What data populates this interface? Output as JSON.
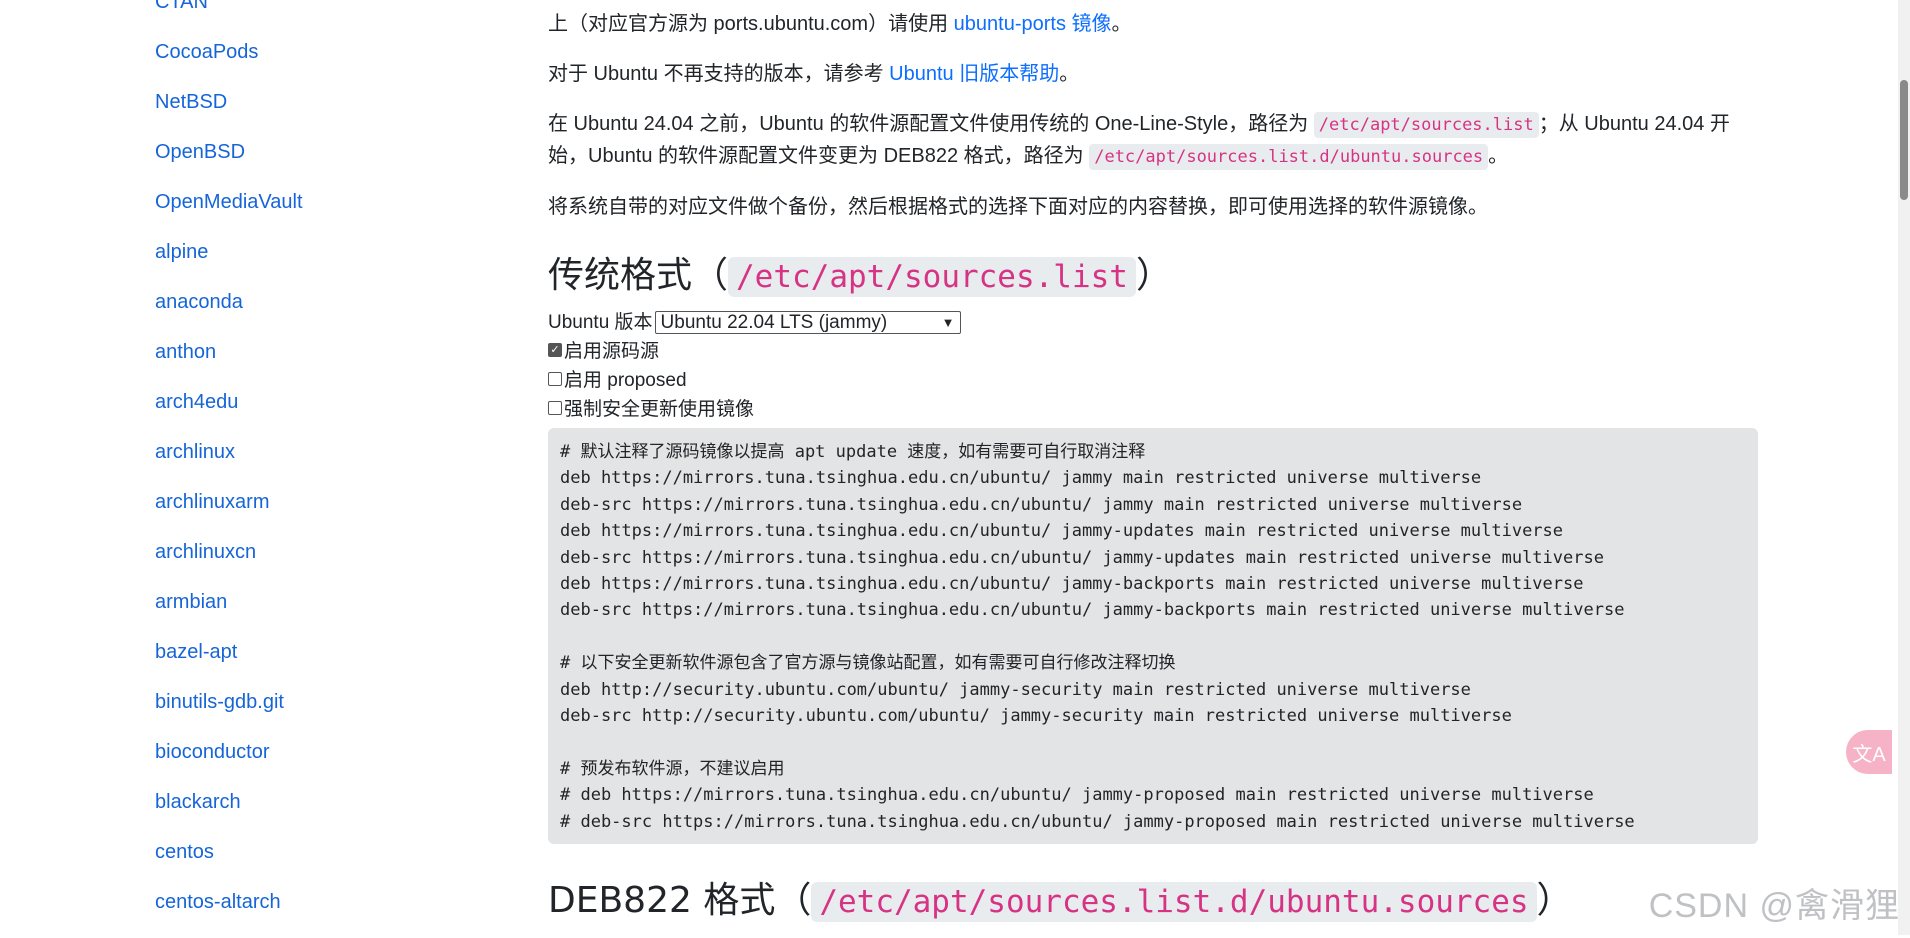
{
  "sidebar": {
    "items": [
      "CTAN",
      "CocoaPods",
      "NetBSD",
      "OpenBSD",
      "OpenMediaVault",
      "alpine",
      "anaconda",
      "anthon",
      "arch4edu",
      "archlinux",
      "archlinuxarm",
      "archlinuxcn",
      "armbian",
      "bazel-apt",
      "binutils-gdb.git",
      "bioconductor",
      "blackarch",
      "centos",
      "centos-altarch"
    ]
  },
  "main": {
    "p1_prefix": "上（对应官方源为 ports.ubuntu.com）请使用 ",
    "p1_link": "ubuntu-ports 镜像",
    "p1_suffix": "。",
    "p2_prefix": "对于 Ubuntu 不再支持的版本，请参考 ",
    "p2_link": "Ubuntu 旧版本帮助",
    "p2_suffix": "。",
    "p3_a": "在 Ubuntu 24.04 之前，Ubuntu 的软件源配置文件使用传统的 One-Line-Style，路径为 ",
    "p3_code1": "/etc/apt/sources.list",
    "p3_b": "；从 Ubuntu 24.04 开始，Ubuntu 的软件源配置文件变更为 DEB822 格式，路径为 ",
    "p3_code2": "/etc/apt/sources.list.d/ubuntu.sources",
    "p3_c": "。",
    "p4": "将系统自带的对应文件做个备份，然后根据格式的选择下面对应的内容替换，即可使用选择的软件源镜像。",
    "h2_1_text": "传统格式（",
    "h2_1_code": "/etc/apt/sources.list",
    "h2_close": "）",
    "version_label": "Ubuntu 版本",
    "version_selected": "Ubuntu 22.04 LTS (jammy)",
    "chk_source": "启用源码源",
    "chk_proposed": "启用 proposed",
    "chk_security": "强制安全更新使用镜像",
    "code_block": "# 默认注释了源码镜像以提高 apt update 速度，如有需要可自行取消注释\ndeb https://mirrors.tuna.tsinghua.edu.cn/ubuntu/ jammy main restricted universe multiverse\ndeb-src https://mirrors.tuna.tsinghua.edu.cn/ubuntu/ jammy main restricted universe multiverse\ndeb https://mirrors.tuna.tsinghua.edu.cn/ubuntu/ jammy-updates main restricted universe multiverse\ndeb-src https://mirrors.tuna.tsinghua.edu.cn/ubuntu/ jammy-updates main restricted universe multiverse\ndeb https://mirrors.tuna.tsinghua.edu.cn/ubuntu/ jammy-backports main restricted universe multiverse\ndeb-src https://mirrors.tuna.tsinghua.edu.cn/ubuntu/ jammy-backports main restricted universe multiverse\n\n# 以下安全更新软件源包含了官方源与镜像站配置，如有需要可自行修改注释切换\ndeb http://security.ubuntu.com/ubuntu/ jammy-security main restricted universe multiverse\ndeb-src http://security.ubuntu.com/ubuntu/ jammy-security main restricted universe multiverse\n\n# 预发布软件源，不建议启用\n# deb https://mirrors.tuna.tsinghua.edu.cn/ubuntu/ jammy-proposed main restricted universe multiverse\n# deb-src https://mirrors.tuna.tsinghua.edu.cn/ubuntu/ jammy-proposed main restricted universe multiverse",
    "h2_2_text": "DEB822 格式（",
    "h2_2_code": "/etc/apt/sources.list.d/ubuntu.sources"
  },
  "overlay": {
    "translate_icon": "文A",
    "watermark": "CSDN @禽滑狸"
  },
  "colors": {
    "link": "#1565d8",
    "code_pink": "#d63384",
    "code_bg": "#e3e4e6"
  }
}
